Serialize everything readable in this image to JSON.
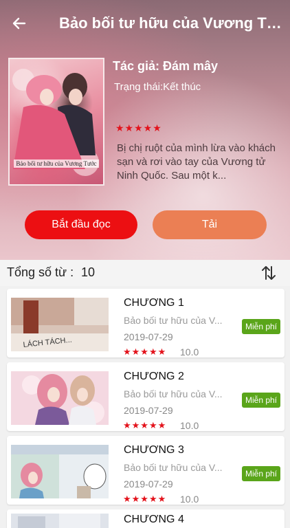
{
  "header": {
    "title": "Bảo bối tư hữu của Vương Tư..."
  },
  "book": {
    "cover_caption": "Bảo bối tư hữu của Vương Tước",
    "author": "Tác giả: Đám mây",
    "status": "Trạng thái:Kết thúc",
    "rating_stars": "★★★★★",
    "description": "Bị chị ruột của mình lừa vào khách sạn và rơi vào tay của Vương tử Ninh Quốc. Sau một k..."
  },
  "actions": {
    "read_label": "Bắt đầu đọc",
    "download_label": "Tải"
  },
  "list_header": {
    "count_label": "Tổng số từ :",
    "count_value": "10"
  },
  "chapters": [
    {
      "title": "CHƯƠNG 1",
      "subtitle": "Bảo bối tư hữu của V...",
      "date": "2019-07-29",
      "stars": "★★★★★",
      "score": "10.0",
      "badge": "Miễn phí",
      "thumb_text": "LÁCH TÁCH..."
    },
    {
      "title": "CHƯƠNG 2",
      "subtitle": "Bảo bối tư hữu của V...",
      "date": "2019-07-29",
      "stars": "★★★★★",
      "score": "10.0",
      "badge": "Miễn phí"
    },
    {
      "title": "CHƯƠNG 3",
      "subtitle": "Bảo bối tư hữu của V...",
      "date": "2019-07-29",
      "stars": "★★★★★",
      "score": "10.0",
      "badge": "Miễn phí"
    },
    {
      "title": "CHƯƠNG 4"
    }
  ],
  "colors": {
    "read_button": "#ec0f12",
    "download_button": "#eb7f54",
    "free_badge": "#5aa51a",
    "stars": "#e3121b"
  },
  "icons": {
    "back": "arrow-left-icon",
    "sort": "sort-arrows-icon"
  }
}
